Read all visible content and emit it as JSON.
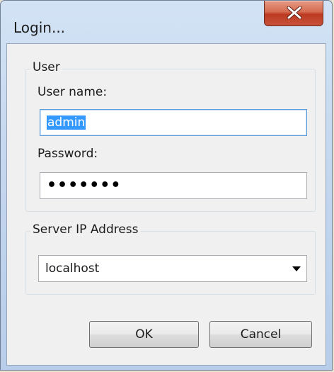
{
  "window": {
    "title": "Login..."
  },
  "user_group": {
    "legend": "User",
    "username_label": "User name:",
    "username_value": "admin",
    "password_label": "Password:",
    "password_mask": "•••••••"
  },
  "server_group": {
    "legend": "Server IP Address",
    "selected_value": "localhost"
  },
  "buttons": {
    "ok_label": "OK",
    "cancel_label": "Cancel"
  },
  "icons": {
    "close": "close-icon",
    "dropdown": "chevron-down-icon"
  }
}
